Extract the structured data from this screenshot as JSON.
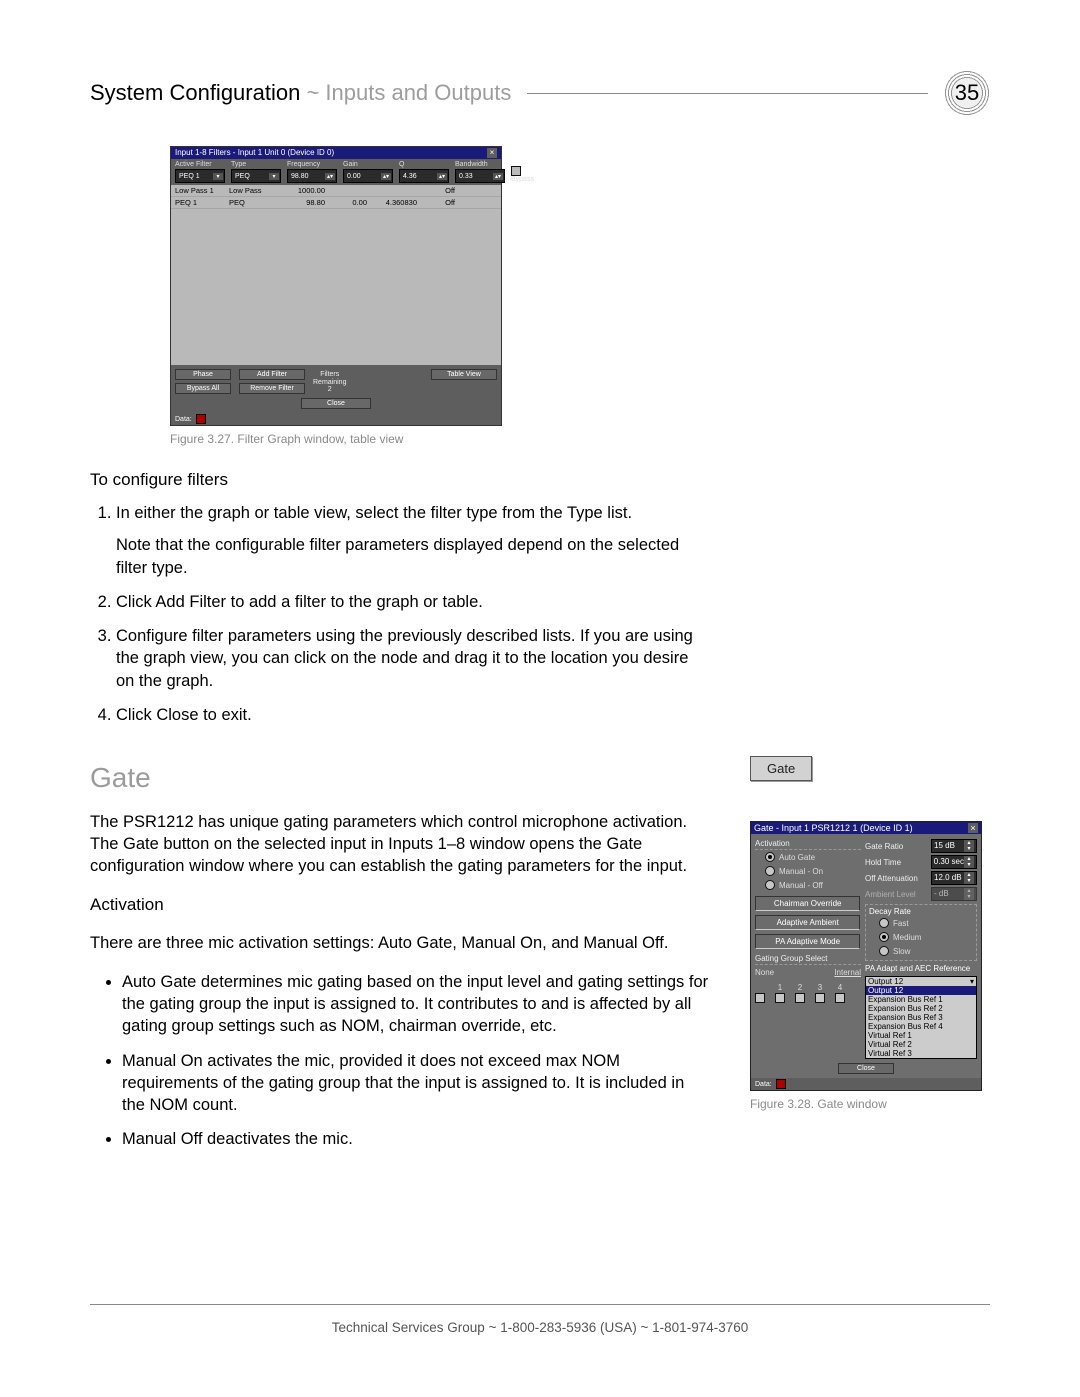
{
  "header": {
    "section": "System Configuration",
    "subsection": "Inputs and Outputs",
    "page_number": "35"
  },
  "figure_filter": {
    "window_title": "Input 1-8 Filters - Input 1  Unit 0 (Device ID 0)",
    "toolbar": {
      "active_filter_label": "Active Filter",
      "active_filter_value": "PEQ 1",
      "type_label": "Type",
      "type_value": "PEQ",
      "frequency_label": "Frequency",
      "frequency_value": "98.80",
      "gain_label": "Gain",
      "gain_value": "0.00",
      "q_label": "Q",
      "q_value": "4.36",
      "bandwidth_label": "Bandwidth",
      "bandwidth_value": "0.33",
      "bypass_label": "Bypass"
    },
    "rows": [
      {
        "name": "Low Pass 1",
        "type": "Low Pass",
        "freq": "1000.00",
        "gain": "",
        "q": "",
        "bw": "Off"
      },
      {
        "name": "PEQ 1",
        "type": "PEQ",
        "freq": "98.80",
        "gain": "0.00",
        "q": "4.360830",
        "bw": "Off"
      }
    ],
    "buttons": {
      "phase": "Phase",
      "bypass_all": "Bypass All",
      "add_filter": "Add Filter",
      "remove_filter": "Remove Filter",
      "table_view": "Table View",
      "close": "Close"
    },
    "filters_remaining_label": "Filters\nRemaining",
    "filters_remaining_value": "2",
    "status_label": "Data:",
    "caption": "Figure 3.27. Filter Graph window, table view"
  },
  "filters_section": {
    "heading": "To configure filters",
    "step1": "In either the graph or table view, select the filter type from the Type list.",
    "step1_note": "Note that the configurable filter parameters displayed depend on the selected filter type.",
    "step2": "Click Add Filter to add a filter to the graph or table.",
    "step3": "Configure filter parameters using the previously described lists. If you are using the graph view, you can click on the node and drag it to the location you desire on the graph.",
    "step4": "Click Close to exit."
  },
  "gate_section": {
    "heading": "Gate",
    "intro": "The PSR1212 has unique gating parameters which control microphone activation. The Gate button on the selected input in Inputs 1–8 window opens the Gate configuration window where you can establish the gating parameters for the input.",
    "activation_heading": "Activation",
    "activation_intro": "There are three mic activation settings: Auto Gate, Manual On, and Manual Off.",
    "bullet_auto": "Auto Gate determines mic gating based on the input level and gating settings for the gating group the input is assigned to. It contributes to and is affected by all gating group settings such as NOM, chairman override, etc.",
    "bullet_on": "Manual On activates the mic, provided it does not exceed max NOM requirements of the gating group that the input is assigned to. It is included in the NOM count.",
    "bullet_off": "Manual Off deactivates the mic."
  },
  "gate_button_label": "Gate",
  "gate_window": {
    "title": "Gate - Input 1  PSR1212 1 (Device ID 1)",
    "activation_label": "Activation",
    "radio_auto": "Auto Gate",
    "radio_on": "Manual - On",
    "radio_off": "Manual - Off",
    "chairman_btn": "Chairman Override",
    "adaptive_btn": "Adaptive Ambient",
    "pa_mode_btn": "PA Adaptive Mode",
    "gating_group_label": "Gating Group Select",
    "internal_label": "Internal",
    "none_label": "None",
    "gate_ratio_label": "Gate Ratio",
    "gate_ratio_value": "15 dB",
    "hold_time_label": "Hold Time",
    "hold_time_value": "0.30 sec",
    "off_atten_label": "Off Attenuation",
    "off_atten_value": "12.0 dB",
    "ambient_label": "Ambient Level",
    "ambient_value": "- dB",
    "decay_label": "Decay Rate",
    "decay_fast": "Fast",
    "decay_medium": "Medium",
    "decay_slow": "Slow",
    "pa_ref_label": "PA Adapt and AEC Reference",
    "pa_ref_selected": "Output 12",
    "options": [
      "Output 12",
      "Expansion Bus Ref 1",
      "Expansion Bus Ref 2",
      "Expansion Bus Ref 3",
      "Expansion Bus Ref 4",
      "Virtual Ref 1",
      "Virtual Ref 2",
      "Virtual Ref 3"
    ],
    "close": "Close",
    "status_label": "Data:",
    "caption": "Figure 3.28. Gate window"
  },
  "footer": "Technical Services Group ~ 1-800-283-5936 (USA) ~ 1-801-974-3760"
}
